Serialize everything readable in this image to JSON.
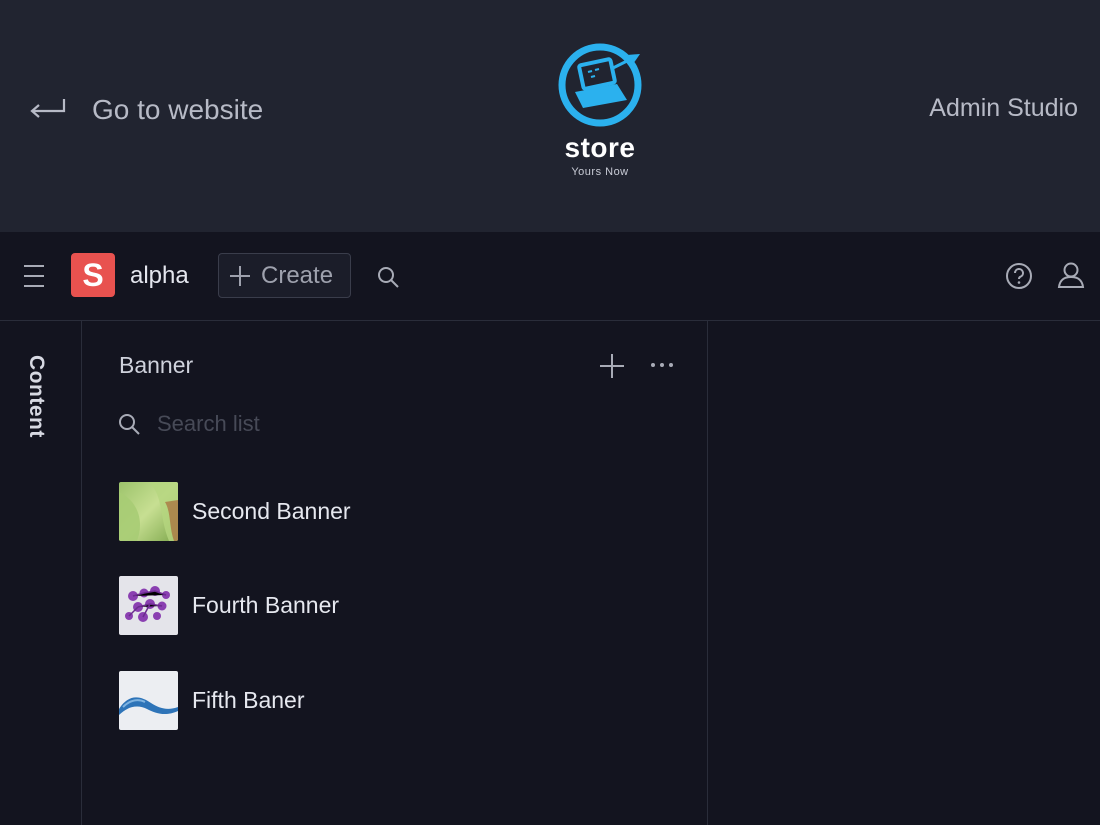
{
  "studio_header": {
    "back_link": "Go to website",
    "logo": {
      "name": "store",
      "tagline": "Yours Now"
    },
    "right_title": "Admin Studio"
  },
  "navbar": {
    "project_initial": "S",
    "project_name": "alpha",
    "create_label": "Create",
    "icons": [
      "menu-icon",
      "search-icon",
      "help-icon",
      "user-icon"
    ]
  },
  "rail": {
    "content_tab": "Content"
  },
  "list_pane": {
    "title": "Banner",
    "search_placeholder": "Search list",
    "items": [
      {
        "title": "Second Banner",
        "thumb": "green-abstract"
      },
      {
        "title": "Fourth Banner",
        "thumb": "purple-molecules"
      },
      {
        "title": "Fifth Baner",
        "thumb": "blue-wave"
      }
    ]
  },
  "colors": {
    "header_bg": "#212430",
    "app_bg": "#13141f",
    "project_badge": "#e8524f",
    "logo_blue": "#2bb1ee"
  }
}
